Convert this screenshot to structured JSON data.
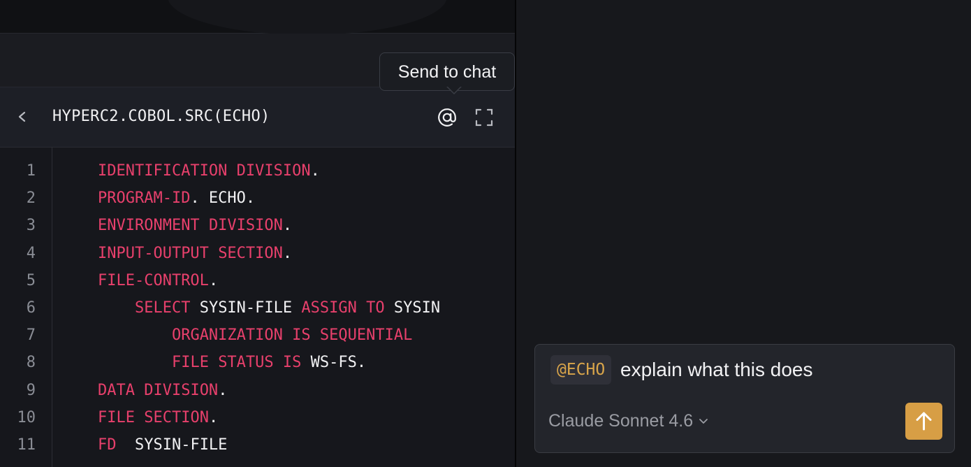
{
  "editor": {
    "file_title": "HYPERC2.COBOL.SRC(ECHO)",
    "back_icon": "chevron-left-icon",
    "mention_icon": "at-sign-icon",
    "expand_icon": "expand-icon",
    "tooltip": "Send to chat",
    "lines": [
      {
        "num": "1",
        "indent": "    ",
        "tokens": [
          {
            "t": "IDENTIFICATION",
            "k": "kw"
          },
          {
            "t": " ",
            "k": "id"
          },
          {
            "t": "DIVISION",
            "k": "kw"
          },
          {
            "t": ".",
            "k": "id"
          }
        ]
      },
      {
        "num": "2",
        "indent": "    ",
        "tokens": [
          {
            "t": "PROGRAM-ID",
            "k": "kw"
          },
          {
            "t": ". ECHO.",
            "k": "id"
          }
        ]
      },
      {
        "num": "3",
        "indent": "    ",
        "tokens": [
          {
            "t": "ENVIRONMENT",
            "k": "kw"
          },
          {
            "t": " ",
            "k": "id"
          },
          {
            "t": "DIVISION",
            "k": "kw"
          },
          {
            "t": ".",
            "k": "id"
          }
        ]
      },
      {
        "num": "4",
        "indent": "    ",
        "tokens": [
          {
            "t": "INPUT-OUTPUT",
            "k": "kw"
          },
          {
            "t": " ",
            "k": "id"
          },
          {
            "t": "SECTION",
            "k": "kw"
          },
          {
            "t": ".",
            "k": "id"
          }
        ]
      },
      {
        "num": "5",
        "indent": "    ",
        "tokens": [
          {
            "t": "FILE-CONTROL",
            "k": "kw"
          },
          {
            "t": ".",
            "k": "id"
          }
        ]
      },
      {
        "num": "6",
        "indent": "        ",
        "tokens": [
          {
            "t": "SELECT",
            "k": "kw"
          },
          {
            "t": " SYSIN-FILE ",
            "k": "id"
          },
          {
            "t": "ASSIGN",
            "k": "kw"
          },
          {
            "t": " ",
            "k": "id"
          },
          {
            "t": "TO",
            "k": "kw"
          },
          {
            "t": " SYSIN",
            "k": "id"
          }
        ]
      },
      {
        "num": "7",
        "indent": "            ",
        "tokens": [
          {
            "t": "ORGANIZATION",
            "k": "kw"
          },
          {
            "t": " ",
            "k": "id"
          },
          {
            "t": "IS",
            "k": "kw"
          },
          {
            "t": " ",
            "k": "id"
          },
          {
            "t": "SEQUENTIAL",
            "k": "kw"
          }
        ]
      },
      {
        "num": "8",
        "indent": "            ",
        "tokens": [
          {
            "t": "FILE",
            "k": "kw"
          },
          {
            "t": " ",
            "k": "id"
          },
          {
            "t": "STATUS",
            "k": "kw"
          },
          {
            "t": " ",
            "k": "id"
          },
          {
            "t": "IS",
            "k": "kw"
          },
          {
            "t": " WS-FS.",
            "k": "id"
          }
        ]
      },
      {
        "num": "9",
        "indent": "    ",
        "tokens": [
          {
            "t": "DATA",
            "k": "kw"
          },
          {
            "t": " ",
            "k": "id"
          },
          {
            "t": "DIVISION",
            "k": "kw"
          },
          {
            "t": ".",
            "k": "id"
          }
        ]
      },
      {
        "num": "10",
        "indent": "    ",
        "tokens": [
          {
            "t": "FILE",
            "k": "kw"
          },
          {
            "t": " ",
            "k": "id"
          },
          {
            "t": "SECTION",
            "k": "kw"
          },
          {
            "t": ".",
            "k": "id"
          }
        ]
      },
      {
        "num": "11",
        "indent": "    ",
        "tokens": [
          {
            "t": "FD",
            "k": "kw"
          },
          {
            "t": "  SYSIN-FILE",
            "k": "id"
          }
        ]
      }
    ]
  },
  "chat": {
    "mention": "@ECHO",
    "message": "explain what this does",
    "model": "Claude Sonnet 4.6",
    "model_icon": "chevron-down-icon",
    "send_icon": "arrow-up-icon"
  },
  "colors": {
    "keyword": "#e8406c",
    "identifier": "#f2f2f4",
    "line_number": "#8a8d95",
    "accent": "#d79e45",
    "mention_text": "#d9a54a"
  }
}
